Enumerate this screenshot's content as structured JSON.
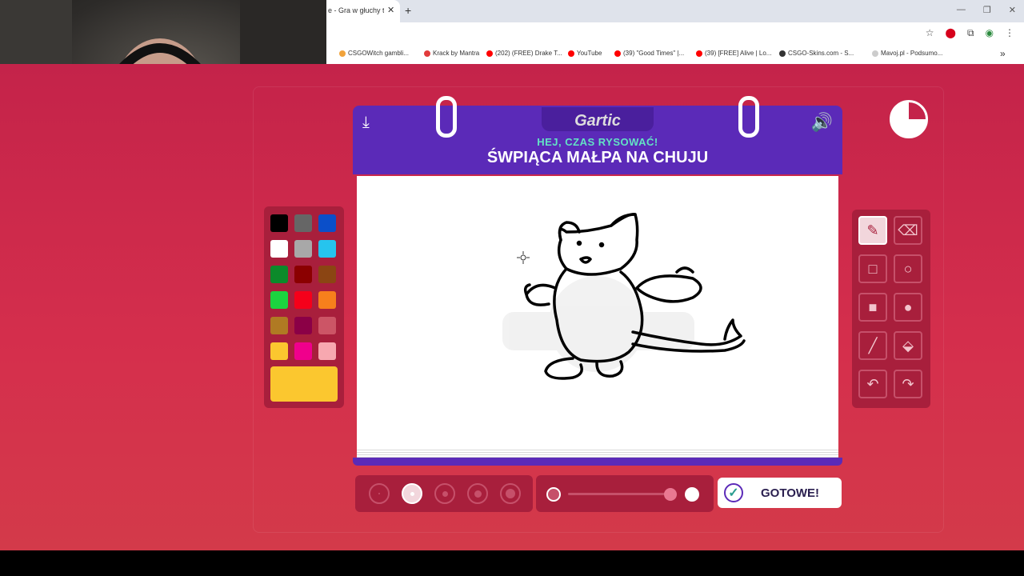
{
  "browser": {
    "tab_title": "e - Gra w głuchy tel",
    "tab_close": "✕",
    "new_tab": "+",
    "window_controls": [
      "—",
      "❐",
      "✕"
    ],
    "bookmarks": [
      {
        "label": "CSGOWitch gambli...",
        "color": "#f1a33b"
      },
      {
        "label": "Krack by Mantra",
        "color": "#e23b3b"
      },
      {
        "label": "(202) (FREE) Drake T...",
        "color": "#ff0000"
      },
      {
        "label": "YouTube",
        "color": "#ff0000"
      },
      {
        "label": "(39) \"Good Times\" |...",
        "color": "#ff0000"
      },
      {
        "label": "(39) [FREE] Alive | Lo...",
        "color": "#ff0000"
      },
      {
        "label": "CSGO-Skins.com - S...",
        "color": "#333333"
      },
      {
        "label": "Mavoj.pl - Podsumo...",
        "color": "#cccccc"
      }
    ],
    "bookmarks_more": "»"
  },
  "game": {
    "logo": "Gartic",
    "subtitle": "HEJ, CZAS RYSOWAĆ!",
    "prompt": "ŚWPIĄCA MAŁPA NA CHUJU",
    "download_icon": "⤓",
    "volume_icon": "🔊",
    "colors": [
      "#000000",
      "#666666",
      "#0b4fc9",
      "#ffffff",
      "#a8a8a8",
      "#26c4ee",
      "#0c8a2a",
      "#8b0000",
      "#8b4513",
      "#1bd43f",
      "#f5001a",
      "#f77f1c",
      "#b07a23",
      "#8b0046",
      "#cc5566",
      "#fbc72f",
      "#f0008c",
      "#f7a8b0"
    ],
    "selected_color": "#fbc72f",
    "tools": [
      {
        "name": "pencil",
        "icon": "✎",
        "active": true
      },
      {
        "name": "eraser",
        "icon": "⌫",
        "active": false
      },
      {
        "name": "rectangle-outline",
        "icon": "□",
        "active": false
      },
      {
        "name": "ellipse-outline",
        "icon": "○",
        "active": false
      },
      {
        "name": "rectangle-fill",
        "icon": "■",
        "active": false
      },
      {
        "name": "ellipse-fill",
        "icon": "●",
        "active": false
      },
      {
        "name": "line",
        "icon": "╱",
        "active": false
      },
      {
        "name": "fill-bucket",
        "icon": "⬙",
        "active": false
      },
      {
        "name": "undo",
        "icon": "↶",
        "active": false
      },
      {
        "name": "redo",
        "icon": "↷",
        "active": false
      }
    ],
    "brush_sizes": [
      {
        "size": 2,
        "active": false
      },
      {
        "size": 5,
        "active": true
      },
      {
        "size": 7,
        "active": false
      },
      {
        "size": 9,
        "active": false
      },
      {
        "size": 12,
        "active": false
      }
    ],
    "done_label": "GOTOWE!",
    "done_icon": "✓"
  }
}
